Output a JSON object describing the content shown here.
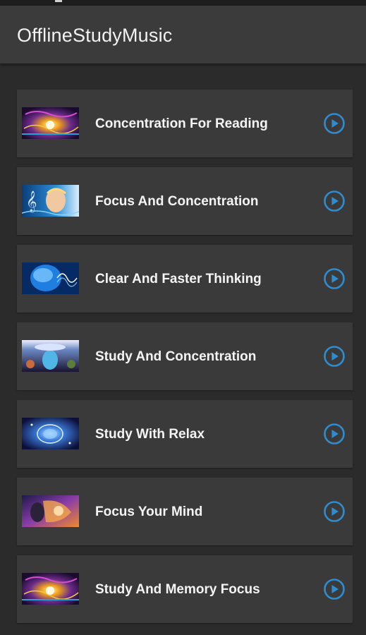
{
  "app": {
    "title": "OfflineStudyMusic"
  },
  "colors": {
    "app_bar": "#3b3b3b",
    "background": "#2b2b2b",
    "card": "#3a3a3a",
    "play_accent": "#2e8ccf"
  },
  "tracks": [
    {
      "label": "Concentration For Reading",
      "icon": "play-circle-icon"
    },
    {
      "label": "Focus And Concentration",
      "icon": "play-circle-icon"
    },
    {
      "label": "Clear And Faster Thinking",
      "icon": "play-circle-icon"
    },
    {
      "label": "Study And Concentration",
      "icon": "play-circle-icon"
    },
    {
      "label": "Study With Relax",
      "icon": "play-circle-icon"
    },
    {
      "label": "Focus Your Mind",
      "icon": "play-circle-icon"
    },
    {
      "label": "Study And Memory Focus",
      "icon": "play-circle-icon"
    }
  ]
}
